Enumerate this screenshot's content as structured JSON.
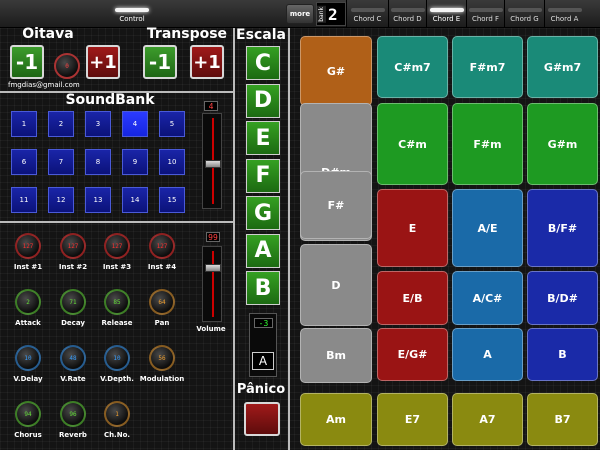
{
  "topbar": {
    "control_tab": "Control",
    "more_label": "more",
    "bank_label": "bank",
    "bank_number": "2",
    "chord_tabs": [
      "Chord C",
      "Chord D",
      "Chord E",
      "Chord F",
      "Chord G",
      "Chord A"
    ],
    "active_chord_tab": "Chord E"
  },
  "oitava": {
    "title": "Oitava",
    "minus": "-1",
    "plus": "+1",
    "knob_value": "0"
  },
  "transpose": {
    "title": "Transpose",
    "minus": "-1",
    "plus": "+1"
  },
  "email": "fmgdias@gmail.com",
  "soundbank": {
    "title": "SoundBank",
    "buttons": [
      "1",
      "2",
      "3",
      "4",
      "5",
      "6",
      "7",
      "8",
      "9",
      "10",
      "11",
      "12",
      "13",
      "14",
      "15"
    ],
    "selected": "4",
    "slider_value": "4",
    "slider_level": 0.47
  },
  "instruments": {
    "knobs": [
      {
        "label": "Inst #1",
        "value": "127",
        "color": "#ff3030"
      },
      {
        "label": "Inst #2",
        "value": "127",
        "color": "#ff3030"
      },
      {
        "label": "Inst #3",
        "value": "127",
        "color": "#ff3030"
      },
      {
        "label": "Inst #4",
        "value": "127",
        "color": "#ff3030"
      }
    ],
    "volume_label": "Volume",
    "volume_value": "99",
    "volume_level": 0.78
  },
  "params": {
    "knobs": [
      {
        "label": "Attack",
        "value": "2",
        "color": "#66e03a"
      },
      {
        "label": "Decay",
        "value": "71",
        "color": "#66e03a"
      },
      {
        "label": "Release",
        "value": "85",
        "color": "#66e03a"
      },
      {
        "label": "Pan",
        "value": "64",
        "color": "#f0a030"
      },
      {
        "label": "V.Delay",
        "value": "10",
        "color": "#3aa0ff"
      },
      {
        "label": "V.Rate",
        "value": "48",
        "color": "#3aa0ff"
      },
      {
        "label": "V.Depth.",
        "value": "10",
        "color": "#3aa0ff"
      },
      {
        "label": "Modulation",
        "value": "56",
        "color": "#f0a030"
      },
      {
        "label": "Chorus",
        "value": "94",
        "color": "#66e03a"
      },
      {
        "label": "Reverb",
        "value": "96",
        "color": "#66e03a"
      },
      {
        "label": "Ch.No.",
        "value": "1",
        "color": "#f0a030"
      }
    ]
  },
  "escala": {
    "title": "Escala",
    "notes": [
      "C",
      "D",
      "E",
      "F",
      "G",
      "A",
      "B"
    ],
    "offset_value": "-3",
    "current_key": "A"
  },
  "panico": {
    "title": "Pânico"
  },
  "pads": {
    "col1": [
      {
        "label": "G#",
        "color": "#b06018"
      },
      {
        "label": "D#m",
        "color": "#8a8a8a"
      },
      {
        "label": "F#",
        "color": "#8a8a8a"
      },
      {
        "label": "D",
        "color": "#8a8a8a"
      },
      {
        "label": "Bm",
        "color": "#8a8a8a"
      },
      {
        "label": "Am",
        "color": "#8a8a10"
      }
    ],
    "row_top": [
      {
        "label": "C#m7",
        "color": "#1a8a78"
      },
      {
        "label": "F#m7",
        "color": "#1a8a78"
      },
      {
        "label": "G#m7",
        "color": "#1a8a78"
      }
    ],
    "row_green": [
      {
        "label": "C#m",
        "color": "#1e9a22"
      },
      {
        "label": "F#m",
        "color": "#1e9a22"
      },
      {
        "label": "G#m",
        "color": "#1e9a22"
      }
    ],
    "row_mid": [
      {
        "label": "E",
        "color": "#9a1414"
      },
      {
        "label": "A/E",
        "color": "#1a6aa8"
      },
      {
        "label": "B/F#",
        "color": "#1a2aa8"
      }
    ],
    "row_slash": [
      {
        "label": "E/B",
        "color": "#9a1414"
      },
      {
        "label": "A/C#",
        "color": "#1a6aa8"
      },
      {
        "label": "B/D#",
        "color": "#1a2aa8"
      }
    ],
    "row_low": [
      {
        "label": "E/G#",
        "color": "#9a1414"
      },
      {
        "label": "A",
        "color": "#1a6aa8"
      },
      {
        "label": "B",
        "color": "#1a2aa8"
      }
    ],
    "row_bottom": [
      {
        "label": "E7",
        "color": "#8a8a10"
      },
      {
        "label": "A7",
        "color": "#8a8a10"
      },
      {
        "label": "B7",
        "color": "#8a8a10"
      }
    ]
  }
}
